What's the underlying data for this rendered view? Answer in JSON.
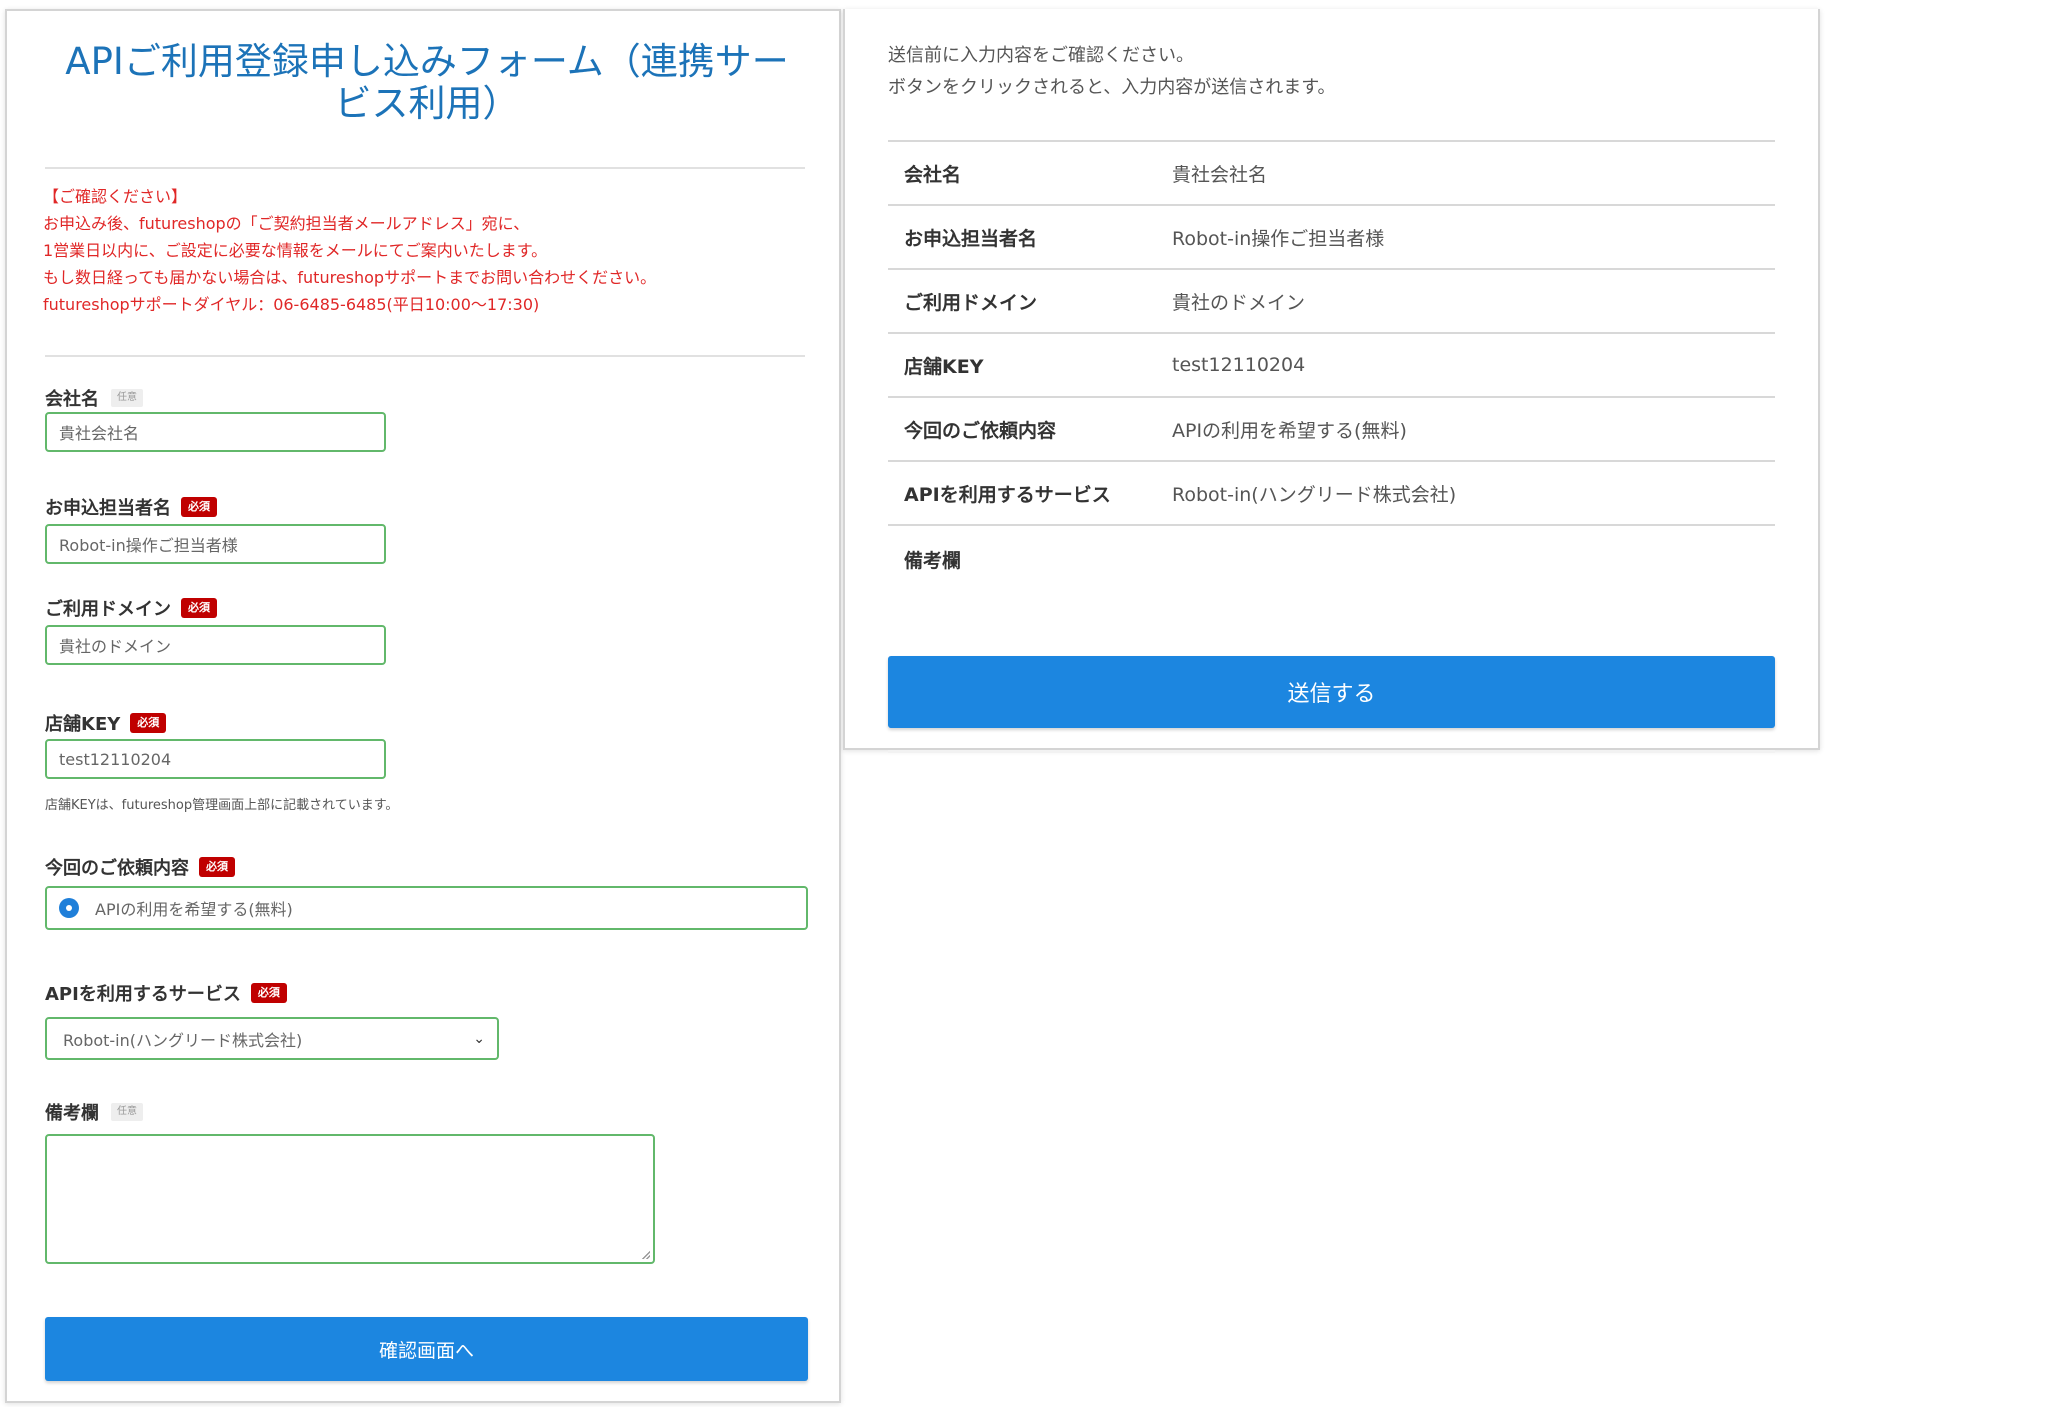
{
  "form": {
    "title": "APIご利用登録申し込みフォーム（連携サービス利用）",
    "notice": [
      "【ご確認ください】",
      "お申込み後、futureshopの「ご契約担当者メールアドレス」宛に、",
      "1営業日以内に、ご設定に必要な情報をメールにてご案内いたします。",
      "もし数日経っても届かない場合は、futureshopサポートまでお問い合わせください。",
      "futureshopサポートダイヤル：06-6485-6485(平日10:00～17:30)"
    ],
    "required_badge": "必須",
    "optional_badge": "任意",
    "company": {
      "label": "会社名",
      "value": "貴社会社名"
    },
    "applicant": {
      "label": "お申込担当者名",
      "value": "Robot-in操作ご担当者様"
    },
    "domain": {
      "label": "ご利用ドメイン",
      "value": "貴社のドメイン"
    },
    "store_key": {
      "label": "店舗KEY",
      "value": "test12110204",
      "hint": "店舗KEYは、futureshop管理画面上部に記載されています。"
    },
    "request": {
      "label": "今回のご依頼内容",
      "option": "APIの利用を希望する(無料)"
    },
    "service": {
      "label": "APIを利用するサービス",
      "selected": "Robot-in(ハングリード株式会社)"
    },
    "remarks": {
      "label": "備考欄",
      "value": ""
    },
    "submit_label": "確認画面へ"
  },
  "confirm": {
    "intro": [
      "送信前に入力内容をご確認ください。",
      "ボタンをクリックされると、入力内容が送信されます。"
    ],
    "rows": [
      {
        "key": "会社名",
        "value": "貴社会社名"
      },
      {
        "key": "お申込担当者名",
        "value": "Robot-in操作ご担当者様"
      },
      {
        "key": "ご利用ドメイン",
        "value": "貴社のドメイン"
      },
      {
        "key": "店舗KEY",
        "value": "test12110204"
      },
      {
        "key": "今回のご依頼内容",
        "value": "APIの利用を希望する(無料)"
      },
      {
        "key": "APIを利用するサービス",
        "value": "Robot-in(ハングリード株式会社)"
      },
      {
        "key": "備考欄",
        "value": ""
      }
    ],
    "send_label": "送信する"
  },
  "colors": {
    "title": "#1c73b8",
    "notice": "#e02727",
    "required_badge": "#c00000",
    "input_border": "#62b86b",
    "button": "#1c86e0"
  }
}
